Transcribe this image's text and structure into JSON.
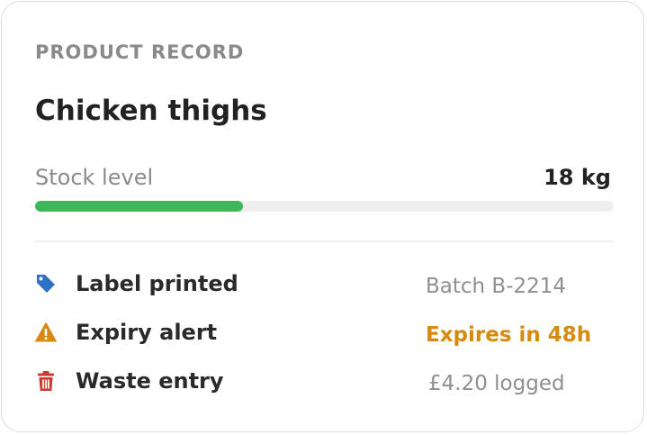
{
  "card": {
    "eyebrow": "PRODUCT RECORD",
    "title": "Chicken thighs",
    "stock": {
      "label": "Stock level",
      "value": "18 kg",
      "fill_fraction": 0.36,
      "fill_color": "#3db75a"
    },
    "events": [
      {
        "icon": "tag-icon",
        "icon_color": "#2d72c5",
        "label": "Label printed",
        "value": "Batch B-2214",
        "value_color": "#8f8f8f"
      },
      {
        "icon": "warning-icon",
        "icon_color": "#d68a10",
        "label": "Expiry alert",
        "value": "Expires in 48h",
        "value_color": "#d68a10"
      },
      {
        "icon": "trash-icon",
        "icon_color": "#cc3a2f",
        "label": "Waste entry",
        "value": "£4.20 logged",
        "value_color": "#8f8f8f"
      }
    ]
  }
}
